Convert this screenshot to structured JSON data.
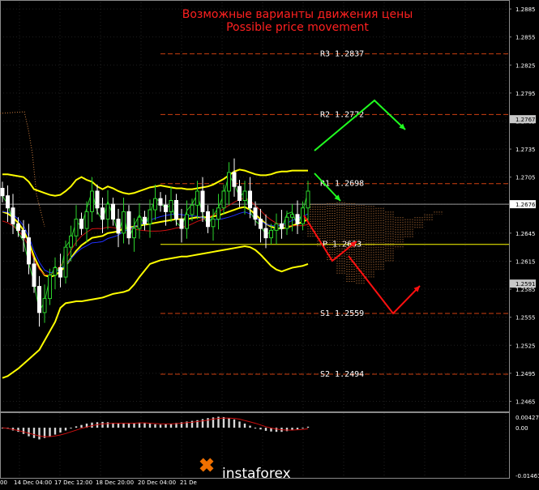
{
  "title_ru": "Возможные варианты движения цены",
  "title_en": "Possible price movement",
  "colors": {
    "background": "#000000",
    "grid": "#1f1f1f",
    "frame": "#8a8a8a",
    "title": "#ff2020",
    "bull_candle": "#2bd12b",
    "bear_candle": "#ffffff",
    "bollinger": "#ffff00",
    "ma_blue": "#2030ff",
    "ma_red": "#d01010",
    "forecast_up": "#20ff20",
    "forecast_down": "#ff1010",
    "resistance_line": "#d04010",
    "pivot_line": "#ffff00",
    "cloud": "#d08040",
    "macd_bars": "#d8d8d8",
    "macd_signal": "#d01010",
    "logo_orange": "#f07000"
  },
  "chart_data": [
    {
      "type": "line",
      "name": "price",
      "title": "",
      "y_ticks": [
        "1.2885",
        "1.2855",
        "1.2825",
        "1.2795",
        "1.2765",
        "1.2735",
        "1.2705",
        "1.2676",
        "1.2645",
        "1.2615",
        "1.2585",
        "1.2555",
        "1.2525",
        "1.2495",
        "1.2465"
      ],
      "x_ticks": [
        "00",
        "14 Dec 04:00",
        "17 Dec 12:00",
        "18 Dec 20:00",
        "20 Dec 04:00",
        "21 De"
      ],
      "ylim": [
        1.2455,
        1.2892
      ],
      "current_price": "1.2676",
      "price_tags": [
        "1.2767",
        "1.2591"
      ],
      "levels": [
        {
          "label": "R3",
          "value": "1.2837"
        },
        {
          "label": "R2",
          "value": "1.2772"
        },
        {
          "label": "R1",
          "value": "1.2698"
        },
        {
          "label": "P",
          "value": "1.2633"
        },
        {
          "label": "S1",
          "value": "1.2559"
        },
        {
          "label": "S2",
          "value": "1.2494"
        }
      ],
      "candles_close": [
        1.2685,
        1.2672,
        1.2655,
        1.2648,
        1.264,
        1.2612,
        1.2588,
        1.256,
        1.2575,
        1.26,
        1.2608,
        1.2598,
        1.263,
        1.2642,
        1.266,
        1.265,
        1.2668,
        1.269,
        1.2672,
        1.266,
        1.2676,
        1.266,
        1.2645,
        1.2668,
        1.264,
        1.265,
        1.2662,
        1.2655,
        1.267,
        1.2682,
        1.2675,
        1.2668,
        1.268,
        1.266,
        1.265,
        1.2665,
        1.2675,
        1.269,
        1.2668,
        1.2652,
        1.266,
        1.2672,
        1.269,
        1.271,
        1.2695,
        1.268,
        1.269,
        1.2672,
        1.266,
        1.265,
        1.264,
        1.2648,
        1.2655,
        1.265,
        1.2662,
        1.2665,
        1.2655,
        1.2672,
        1.269
      ],
      "bollinger_upper": [
        1.2708,
        1.2708,
        1.2707,
        1.2706,
        1.2705,
        1.27,
        1.2692,
        1.269,
        1.2688,
        1.2686,
        1.2685,
        1.2686,
        1.269,
        1.2695,
        1.2702,
        1.2705,
        1.2702,
        1.27,
        1.2695,
        1.2692,
        1.2695,
        1.2693,
        1.269,
        1.2688,
        1.2687,
        1.2688,
        1.269,
        1.2692,
        1.2694,
        1.2695,
        1.2696,
        1.2695,
        1.2694,
        1.2693,
        1.2693,
        1.2692,
        1.2692,
        1.2693,
        1.2694,
        1.2695,
        1.2697,
        1.27,
        1.2703,
        1.2707,
        1.2711,
        1.2713,
        1.2712,
        1.271,
        1.2708,
        1.2707,
        1.2707,
        1.2708,
        1.271,
        1.2711,
        1.2711,
        1.2712,
        1.2712,
        1.2712,
        1.2712
      ],
      "bollinger_middle": [
        1.2668,
        1.2666,
        1.2662,
        1.2656,
        1.2648,
        1.2636,
        1.262,
        1.2608,
        1.26,
        1.2598,
        1.26,
        1.2604,
        1.261,
        1.2618,
        1.2626,
        1.2632,
        1.2636,
        1.264,
        1.2641,
        1.2642,
        1.2645,
        1.2646,
        1.2647,
        1.265,
        1.2651,
        1.2652,
        1.2653,
        1.2654,
        1.2655,
        1.2656,
        1.2657,
        1.2658,
        1.2659,
        1.266,
        1.266,
        1.266,
        1.2661,
        1.2662,
        1.2662,
        1.2662,
        1.2663,
        1.2664,
        1.2666,
        1.2668,
        1.267,
        1.2672,
        1.2673,
        1.267,
        1.2665,
        1.266,
        1.2655,
        1.2652,
        1.265,
        1.265,
        1.2651,
        1.2653,
        1.2655,
        1.2657,
        1.266
      ],
      "bollinger_lower": [
        1.249,
        1.2492,
        1.2496,
        1.25,
        1.2505,
        1.251,
        1.2515,
        1.252,
        1.253,
        1.254,
        1.255,
        1.2565,
        1.257,
        1.2571,
        1.2572,
        1.2572,
        1.2573,
        1.2574,
        1.2575,
        1.2576,
        1.2578,
        1.258,
        1.2581,
        1.2582,
        1.2584,
        1.259,
        1.2598,
        1.2605,
        1.2612,
        1.2614,
        1.2616,
        1.2617,
        1.2618,
        1.2619,
        1.262,
        1.262,
        1.2621,
        1.2622,
        1.2623,
        1.2624,
        1.2625,
        1.2626,
        1.2627,
        1.2628,
        1.2629,
        1.263,
        1.2631,
        1.263,
        1.2627,
        1.2622,
        1.2616,
        1.261,
        1.2606,
        1.2604,
        1.2606,
        1.2608,
        1.2609,
        1.261,
        1.2612
      ]
    },
    {
      "type": "bar",
      "name": "macd",
      "title": "",
      "y_ticks": [
        "0.00427",
        "0.00",
        "-0.01461"
      ],
      "ylim": [
        -0.01461,
        0.00427
      ],
      "values": [
        0.0,
        -0.0003,
        -0.0008,
        -0.0012,
        -0.0018,
        -0.0025,
        -0.003,
        -0.0034,
        -0.003,
        -0.0025,
        -0.002,
        -0.0014,
        -0.0008,
        -0.0002,
        0.0004,
        0.0008,
        0.0012,
        0.0015,
        0.0016,
        0.0017,
        0.0016,
        0.0014,
        0.0013,
        0.0012,
        0.0013,
        0.0014,
        0.0015,
        0.0014,
        0.0012,
        0.001,
        0.0009,
        0.001,
        0.0012,
        0.0014,
        0.0016,
        0.0018,
        0.002,
        0.0022,
        0.0025,
        0.0028,
        0.003,
        0.0032,
        0.0031,
        0.0028,
        0.0024,
        0.0018,
        0.0012,
        0.0006,
        0.0,
        -0.0005,
        -0.0009,
        -0.0011,
        -0.0012,
        -0.0012,
        -0.001,
        -0.0008,
        -0.0005,
        -0.0002,
        0.0003
      ],
      "signal": [
        0.0,
        -0.0002,
        -0.0005,
        -0.0008,
        -0.0012,
        -0.0016,
        -0.002,
        -0.0024,
        -0.0026,
        -0.0026,
        -0.0024,
        -0.0021,
        -0.0017,
        -0.0012,
        -0.0007,
        -0.0002,
        0.0002,
        0.0006,
        0.0009,
        0.0011,
        0.0012,
        0.0013,
        0.0013,
        0.0013,
        0.0013,
        0.0013,
        0.0014,
        0.0014,
        0.0013,
        0.0012,
        0.0011,
        0.0011,
        0.0011,
        0.0012,
        0.0013,
        0.0015,
        0.0016,
        0.0018,
        0.002,
        0.0022,
        0.0025,
        0.0027,
        0.0028,
        0.0028,
        0.0027,
        0.0025,
        0.0021,
        0.0017,
        0.0013,
        0.0008,
        0.0003,
        -0.0001,
        -0.0004,
        -0.0006,
        -0.0007,
        -0.0007,
        -0.0006,
        -0.0005,
        -0.0003
      ]
    }
  ],
  "logo": {
    "brand": "instaforex"
  }
}
